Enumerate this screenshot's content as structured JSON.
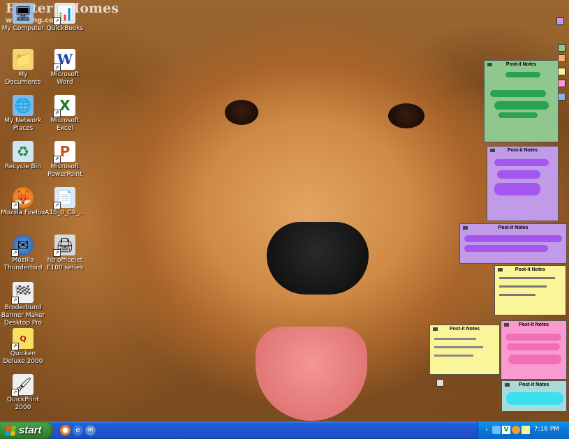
{
  "watermark": {
    "line1": "Better",
    "line2": "Homes",
    "url": "www.bhg.com"
  },
  "desktop_icons": [
    {
      "label": "My Computer",
      "icon": "computer-icon"
    },
    {
      "label": "QuickBooks",
      "icon": "quickbooks-icon"
    },
    {
      "label": "My Documents",
      "icon": "folder-icon"
    },
    {
      "label": "Microsoft Word",
      "icon": "word-icon"
    },
    {
      "label": "My Network Places",
      "icon": "network-icon"
    },
    {
      "label": "Microsoft Excel",
      "icon": "excel-icon"
    },
    {
      "label": "Recycle Bin",
      "icon": "recycle-bin-icon"
    },
    {
      "label": "Microsoft PowerPoint",
      "icon": "powerpoint-icon"
    },
    {
      "label": "Mozilla Firefox",
      "icon": "firefox-icon"
    },
    {
      "label": "A15_0_C9_...",
      "icon": "file-icon"
    },
    {
      "label": "Mozilla Thunderbird",
      "icon": "thunderbird-icon"
    },
    {
      "label": "hp officejet E100 series",
      "icon": "printer-icon"
    },
    {
      "label": "Broderbund Banner Maker Desktop Pro",
      "icon": "banner-icon"
    },
    {
      "label": "Quicken Deluxe 2000",
      "icon": "quicken-icon"
    },
    {
      "label": "QuickPrint 2000",
      "icon": "quickprint-icon"
    }
  ],
  "sticky_notes": {
    "title": "Post-it Notes",
    "colors": {
      "green": "#8fc78f",
      "purple": "#c19ae8",
      "yellow": "#fbf59a",
      "pink": "#f99ad0",
      "teal": "#a8dada",
      "scribble_green": "#1f9e4a",
      "scribble_purple": "#a050f0",
      "scribble_pink": "#f06ab4",
      "scribble_teal": "#2fe0f0"
    }
  },
  "taskbar": {
    "start_label": "start",
    "quick_launch": [
      "firefox-icon",
      "ie-icon",
      "thunderbird-icon"
    ],
    "clock": "7:16 PM"
  }
}
